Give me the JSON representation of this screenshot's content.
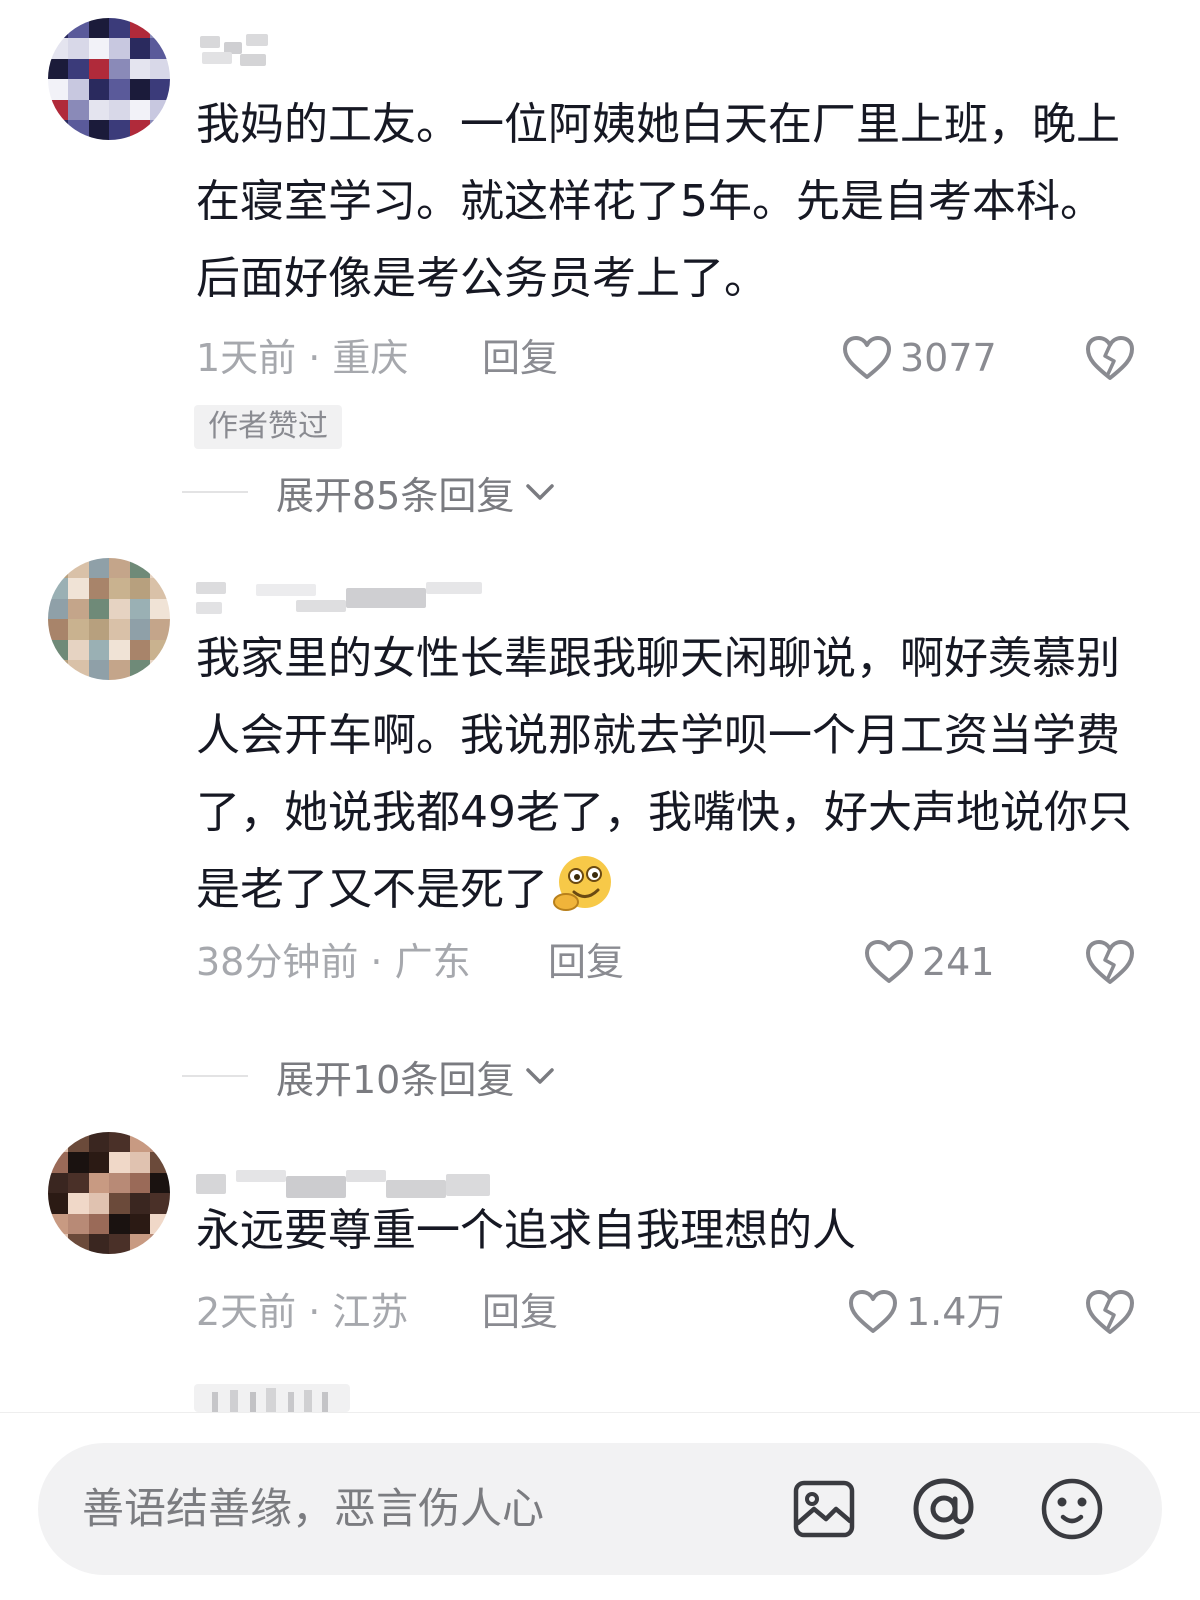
{
  "comments": [
    {
      "text": "我妈的工友。一位阿姨她白天在厂里上班，晚上在寝室学习。就这样花了5年。先是自考本科。后面好像是考公务员考上了。",
      "time_location": "1天前 · 重庆",
      "reply_label": "回复",
      "like_count": "3077",
      "badge": "作者赞过",
      "expand_label": "展开85条回复"
    },
    {
      "text": "我家里的女性长辈跟我聊天闲聊说，啊好羡慕别人会开车啊。我说那就去学呗一个月工资当学费了，她说我都49老了，我嘴快，好大声地说你只是老了又不是死了",
      "emoji": "thinking-grin-emoji",
      "time_location": "38分钟前 · 广东",
      "reply_label": "回复",
      "like_count": "241",
      "expand_label": "展开10条回复"
    },
    {
      "text": "永远要尊重一个追求自我理想的人",
      "time_location": "2天前 · 江苏",
      "reply_label": "回复",
      "like_count": "1.4万"
    }
  ],
  "input": {
    "placeholder": "善语结善缘，恶言伤人心"
  },
  "icons": {
    "like": "heart-outline-icon",
    "dislike": "broken-heart-icon",
    "expand": "chevron-down-icon",
    "image": "image-icon",
    "mention": "at-icon",
    "emoji": "smiley-icon"
  },
  "colors": {
    "text": "#161823",
    "meta": "#a6a8ad",
    "input_bg": "#f2f2f3"
  }
}
